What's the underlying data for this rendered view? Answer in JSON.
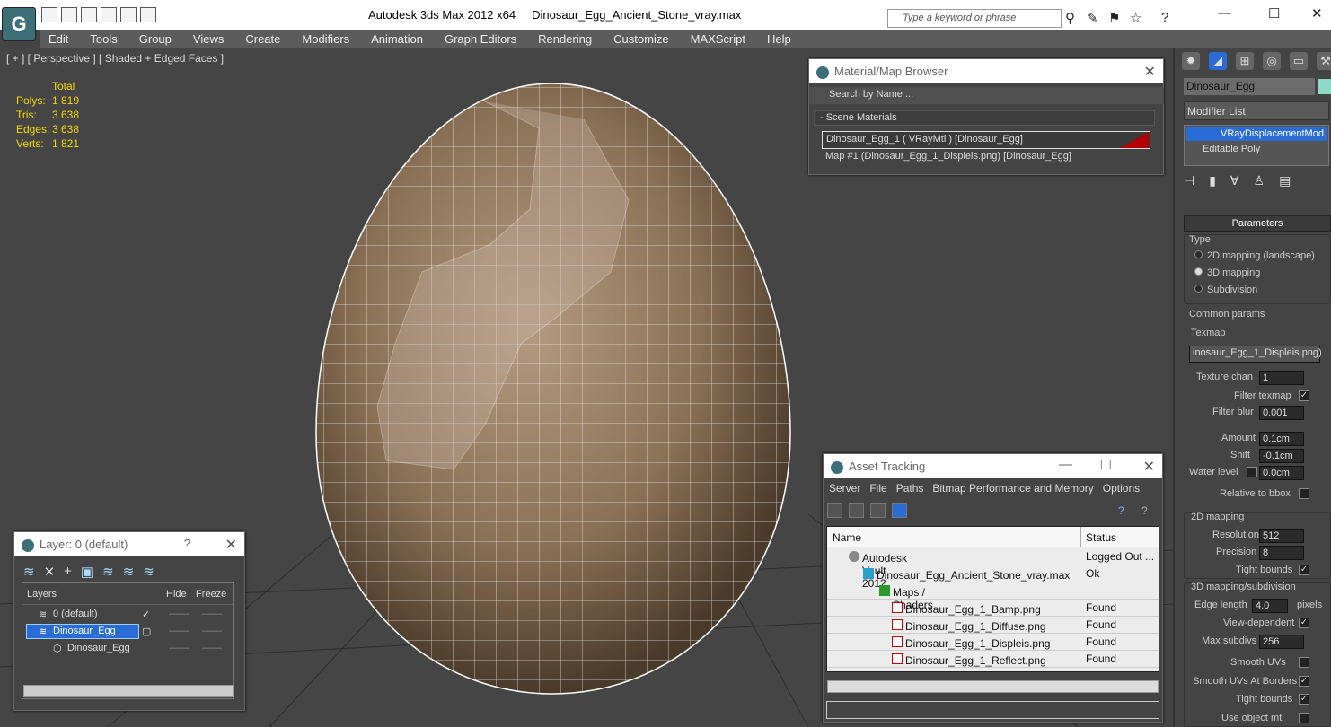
{
  "app": {
    "title": "Autodesk 3ds Max  2012 x64",
    "file": "Dinosaur_Egg_Ancient_Stone_vray.max",
    "logo": "3ds-max-logo-icon"
  },
  "search": {
    "placeholder": "Type a keyword or phrase"
  },
  "menu": [
    "Edit",
    "Tools",
    "Group",
    "Views",
    "Create",
    "Modifiers",
    "Animation",
    "Graph Editors",
    "Rendering",
    "Customize",
    "MAXScript",
    "Help"
  ],
  "viewport": {
    "label": "[ + ] [ Perspective ] [ Shaded + Edged Faces ]",
    "stats_header": "Total",
    "stats": [
      {
        "k": "Polys:",
        "v": "1 819"
      },
      {
        "k": "Tris:",
        "v": "3 638"
      },
      {
        "k": "Edges:",
        "v": "3 638"
      },
      {
        "k": "Verts:",
        "v": "1 821"
      }
    ]
  },
  "mmb": {
    "title": "Material/Map Browser",
    "search": "Search by Name ...",
    "section": "- Scene Materials",
    "rows": [
      "Dinosaur_Egg_1  ( VRayMtl )  [Dinosaur_Egg]",
      "Map #1 (Dinosaur_Egg_1_Displeis.png) [Dinosaur_Egg]"
    ]
  },
  "asset": {
    "title": "Asset Tracking",
    "menu": [
      "Server",
      "File",
      "Paths",
      "Bitmap Performance and Memory",
      "Options"
    ],
    "col_name": "Name",
    "col_status": "Status",
    "rows": [
      {
        "name": "Autodesk Vault 2012",
        "status": "Logged Out ..."
      },
      {
        "name": "Dinosaur_Egg_Ancient_Stone_vray.max",
        "status": "Ok"
      },
      {
        "name": "Maps / Shaders",
        "status": ""
      },
      {
        "name": "Dinosaur_Egg_1_Bamp.png",
        "status": "Found"
      },
      {
        "name": "Dinosaur_Egg_1_Diffuse.png",
        "status": "Found"
      },
      {
        "name": "Dinosaur_Egg_1_Displeis.png",
        "status": "Found"
      },
      {
        "name": "Dinosaur_Egg_1_Reflect.png",
        "status": "Found"
      }
    ]
  },
  "layer": {
    "title": "Layer: 0 (default)",
    "help": "?",
    "col_layers": "Layers",
    "col_hide": "Hide",
    "col_freeze": "Freeze",
    "rows": [
      "0 (default)",
      "Dinosaur_Egg",
      "Dinosaur_Egg"
    ]
  },
  "cmd": {
    "object_name": "Dinosaur_Egg",
    "modifier_list": "Modifier List",
    "stack": [
      "VRayDisplacementMod",
      "Editable Poly"
    ],
    "rollout": "Parameters",
    "type_label": "Type",
    "types": [
      "2D mapping (landscape)",
      "3D mapping",
      "Subdivision"
    ],
    "common": "Common params",
    "texmap_label": "Texmap",
    "texmap": "inosaur_Egg_1_Displeis.png)",
    "texture_chan_label": "Texture chan",
    "texture_chan": "1",
    "filter_texmap": "Filter texmap",
    "filter_blur_label": "Filter blur",
    "filter_blur": "0.001",
    "amount_label": "Amount",
    "amount": "0.1cm",
    "shift_label": "Shift",
    "shift": "-0.1cm",
    "water_label": "Water level",
    "water": "0.0cm",
    "relative": "Relative to bbox",
    "g2d": "2D mapping",
    "resolution_label": "Resolution",
    "resolution": "512",
    "precision_label": "Precision",
    "precision": "8",
    "tight1": "Tight bounds",
    "g3d": "3D mapping/subdivision",
    "edge_label": "Edge length",
    "edge": "4.0",
    "pixels": "pixels",
    "viewdep": "View-dependent",
    "maxsub_label": "Max subdivs",
    "maxsub": "256",
    "smooth": "Smooth UVs",
    "smoothb": "Smooth UVs At Borders",
    "tight2": "Tight bounds",
    "useobj": "Use object mtl"
  }
}
